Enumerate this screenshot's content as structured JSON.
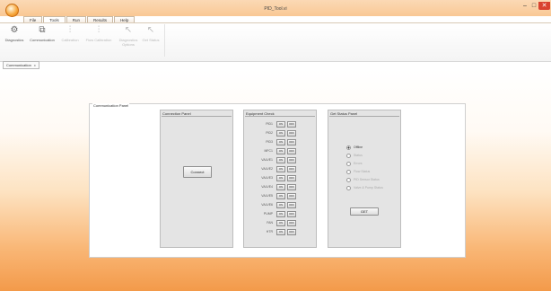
{
  "window": {
    "title": "PID_Tool.vi"
  },
  "tabs": [
    "File",
    "Tools",
    "Run",
    "Results",
    "Help"
  ],
  "active_tab": "Tools",
  "ribbon": {
    "buttons": [
      {
        "label": "Diagnostics",
        "icon": "gear-icon",
        "enabled": true
      },
      {
        "label": "Communication",
        "icon": "network-icon",
        "enabled": true
      },
      {
        "label": "Calibration",
        "icon": "probe-icon",
        "enabled": false
      },
      {
        "label": "Flow Calibration",
        "icon": "probe-icon",
        "enabled": false
      },
      {
        "label": "Diagnostics Options",
        "icon": "cursor-icon",
        "enabled": false
      },
      {
        "label": "Get Status",
        "icon": "cursor-icon",
        "enabled": false
      }
    ]
  },
  "doc_tab": {
    "label": "Communication",
    "close": "x"
  },
  "panel": {
    "title": "Communication Panel",
    "connection": {
      "title": "Connection Panel",
      "button": "Connect"
    },
    "equipment": {
      "title": "Equipment Check",
      "on_label": "ON",
      "off_label": "OFF",
      "rows": [
        "PID1",
        "PID2",
        "PID3",
        "MFC1",
        "VALVE1",
        "VALVE2",
        "VALVE3",
        "VALVE4",
        "VALVE5",
        "VALVE6",
        "PUMP",
        "FAN",
        "HTR"
      ]
    },
    "status": {
      "title": "Get Status Panel",
      "options": [
        "Offline",
        "Status",
        "Errors",
        "Flow Status",
        "PID Sensor Status",
        "Valve & Pump Status"
      ],
      "selected": 0,
      "button": "GET"
    }
  }
}
